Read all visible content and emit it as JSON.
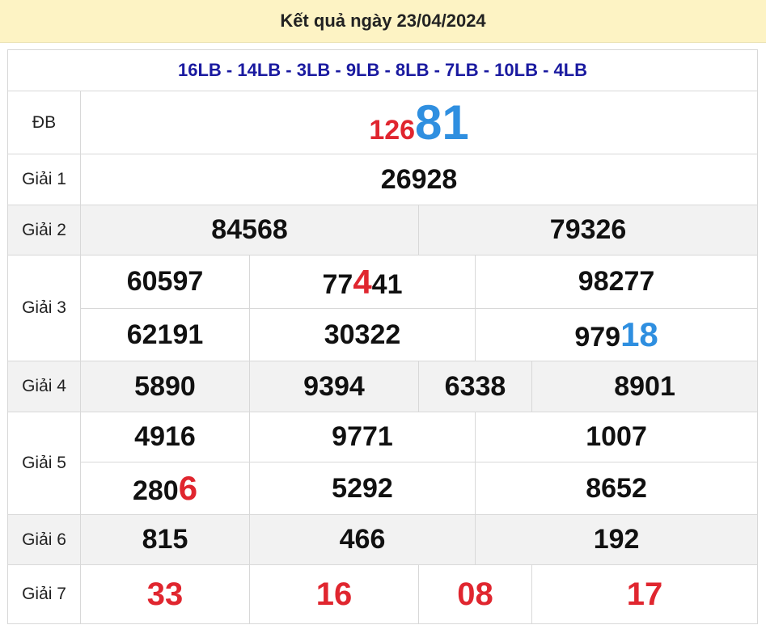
{
  "header": {
    "title": "Kết quả ngày 23/04/2024"
  },
  "codes": "16LB - 14LB - 3LB - 9LB - 8LB - 7LB - 10LB - 4LB",
  "prizes": {
    "db": {
      "label": "ĐB",
      "number_prefix": "126",
      "number_suffix": "81"
    },
    "g1": {
      "label": "Giải 1",
      "numbers": [
        "26928"
      ]
    },
    "g2": {
      "label": "Giải 2",
      "numbers": [
        "84568",
        "79326"
      ]
    },
    "g3": {
      "label": "Giải 3",
      "numbers": [
        "60597",
        "77441",
        "98277",
        "62191",
        "30322",
        "97918"
      ],
      "n2": {
        "pre": "77",
        "hi": "4",
        "post": "41"
      },
      "n6": {
        "pre": "979",
        "hi": "18"
      }
    },
    "g4": {
      "label": "Giải 4",
      "numbers": [
        "5890",
        "9394",
        "6338",
        "8901"
      ]
    },
    "g5": {
      "label": "Giải 5",
      "numbers": [
        "4916",
        "9771",
        "1007",
        "2806",
        "5292",
        "8652"
      ],
      "n4": {
        "pre": "280",
        "hi": "6"
      }
    },
    "g6": {
      "label": "Giải 6",
      "numbers": [
        "815",
        "466",
        "192"
      ]
    },
    "g7": {
      "label": "Giải 7",
      "numbers": [
        "33",
        "16",
        "08",
        "17"
      ]
    }
  },
  "colors": {
    "highlight_red": "#e0262f",
    "highlight_blue": "#2f8fe0",
    "codes_blue": "#1a1aa0",
    "header_bg": "#fdf3c4"
  }
}
